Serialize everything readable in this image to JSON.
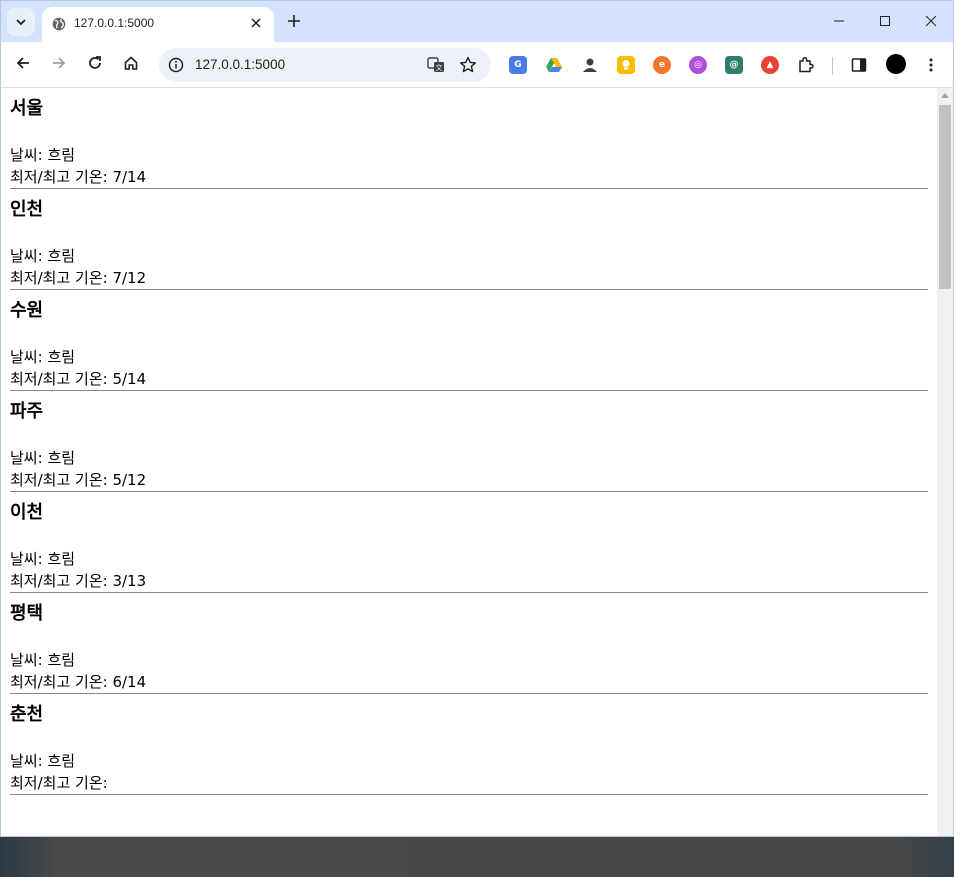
{
  "browser": {
    "tab": {
      "title": "127.0.0.1:5000"
    },
    "address": {
      "url": "127.0.0.1:5000"
    },
    "new_tab_symbol": "+"
  },
  "colors": {
    "tabbar_bg": "#d3e3fd",
    "omnibox_bg": "#eef1f7",
    "divider": "#888888"
  },
  "icons": [
    "tab-search-icon",
    "globe-icon",
    "close-icon",
    "plus-icon",
    "minimize-icon",
    "maximize-icon",
    "window-close-icon",
    "back-arrow-icon",
    "forward-arrow-icon",
    "reload-icon",
    "home-icon",
    "info-icon",
    "translate-icon",
    "star-icon",
    "puzzle-icon",
    "side-panel-icon",
    "kebab-menu-icon"
  ],
  "weather": {
    "label_weather": "날씨: ",
    "label_temp": "최저/최고 기온: ",
    "cities": [
      {
        "name": "서울",
        "weather": "흐림",
        "temp": "7/14"
      },
      {
        "name": "인천",
        "weather": "흐림",
        "temp": "7/12"
      },
      {
        "name": "수원",
        "weather": "흐림",
        "temp": "5/14"
      },
      {
        "name": "파주",
        "weather": "흐림",
        "temp": "5/12"
      },
      {
        "name": "이천",
        "weather": "흐림",
        "temp": "3/13"
      },
      {
        "name": "평택",
        "weather": "흐림",
        "temp": "6/14"
      },
      {
        "name": "춘천",
        "weather": "흐림",
        "temp": ""
      }
    ]
  }
}
